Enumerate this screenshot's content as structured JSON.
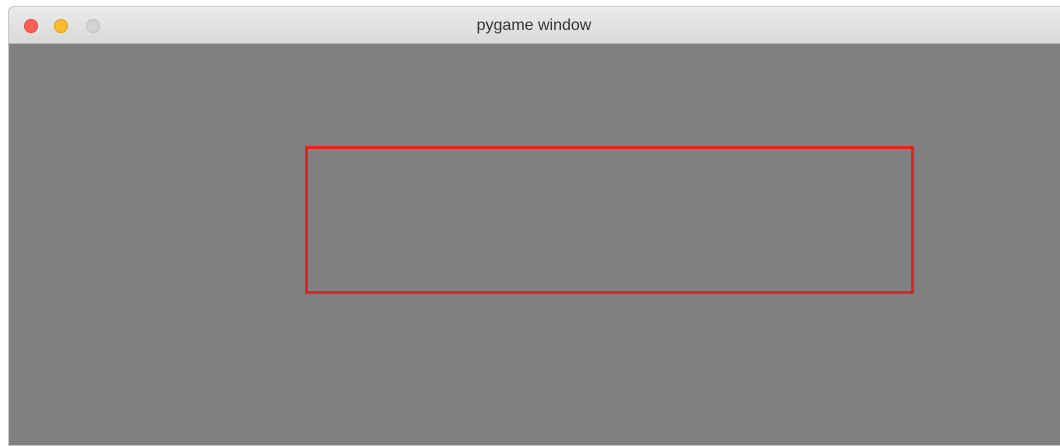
{
  "window": {
    "title": "pygame window"
  },
  "colors": {
    "canvas_background": "#808080",
    "rectangle_outline": "#e8201e",
    "close_button": "#fe5f57",
    "minimize_button": "#febc2e",
    "zoom_button_inactive": "#d3d3d3"
  }
}
